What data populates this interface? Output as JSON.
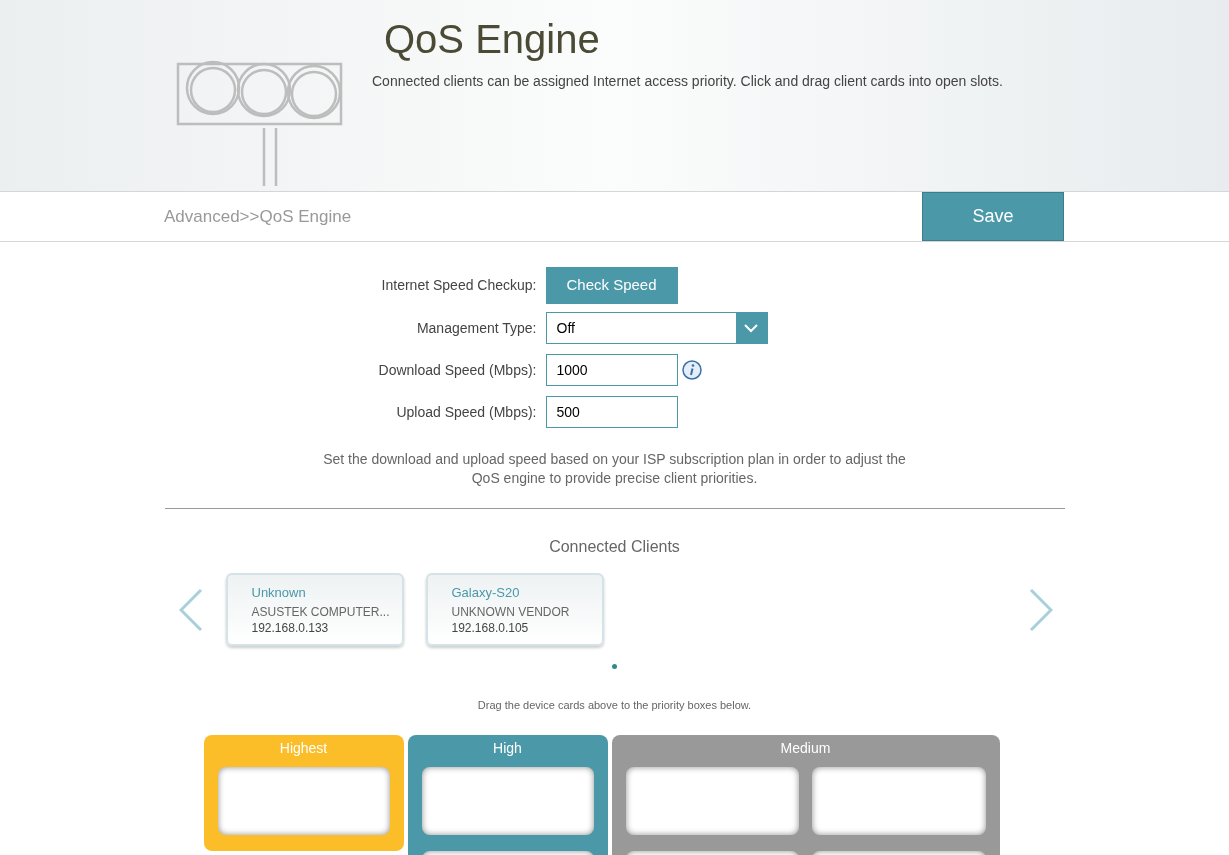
{
  "header": {
    "title": "QoS Engine",
    "description": "Connected clients can be assigned Internet access priority. Click and drag client cards into open slots."
  },
  "breadcrumb": "Advanced>>QoS Engine",
  "save_button": "Save",
  "form": {
    "speed_checkup": {
      "label": "Internet Speed Checkup:",
      "button": "Check Speed"
    },
    "management_type": {
      "label": "Management Type:",
      "value": "Off"
    },
    "download_speed": {
      "label": "Download Speed (Mbps):",
      "value": "1000"
    },
    "upload_speed": {
      "label": "Upload Speed (Mbps):",
      "value": "500"
    },
    "note": "Set the download and upload speed based on your ISP subscription plan in order to adjust the QoS engine to provide precise client priorities."
  },
  "connected_clients": {
    "title": "Connected Clients",
    "clients": [
      {
        "name": "Unknown",
        "vendor": "ASUSTEK COMPUTER...",
        "ip": "192.168.0.133"
      },
      {
        "name": "Galaxy-S20",
        "vendor": "UNKNOWN VENDOR",
        "ip": "192.168.0.105"
      }
    ],
    "pages": [
      {
        "selected": true
      }
    ],
    "hint": "Drag the device cards above to the priority boxes below."
  },
  "priority_groups": [
    {
      "label": "Highest",
      "color": "#fbbd28",
      "slots": [
        {
          "kind": "empty"
        }
      ]
    },
    {
      "label": "High",
      "color": "#4a98a8",
      "slots": [
        {
          "kind": "empty"
        },
        {
          "kind": "empty"
        }
      ]
    },
    {
      "label": "Medium",
      "color": "#999999",
      "slots": [
        {
          "kind": "empty"
        },
        {
          "kind": "empty"
        },
        {
          "kind": "empty"
        },
        {
          "kind": "empty"
        }
      ]
    }
  ]
}
